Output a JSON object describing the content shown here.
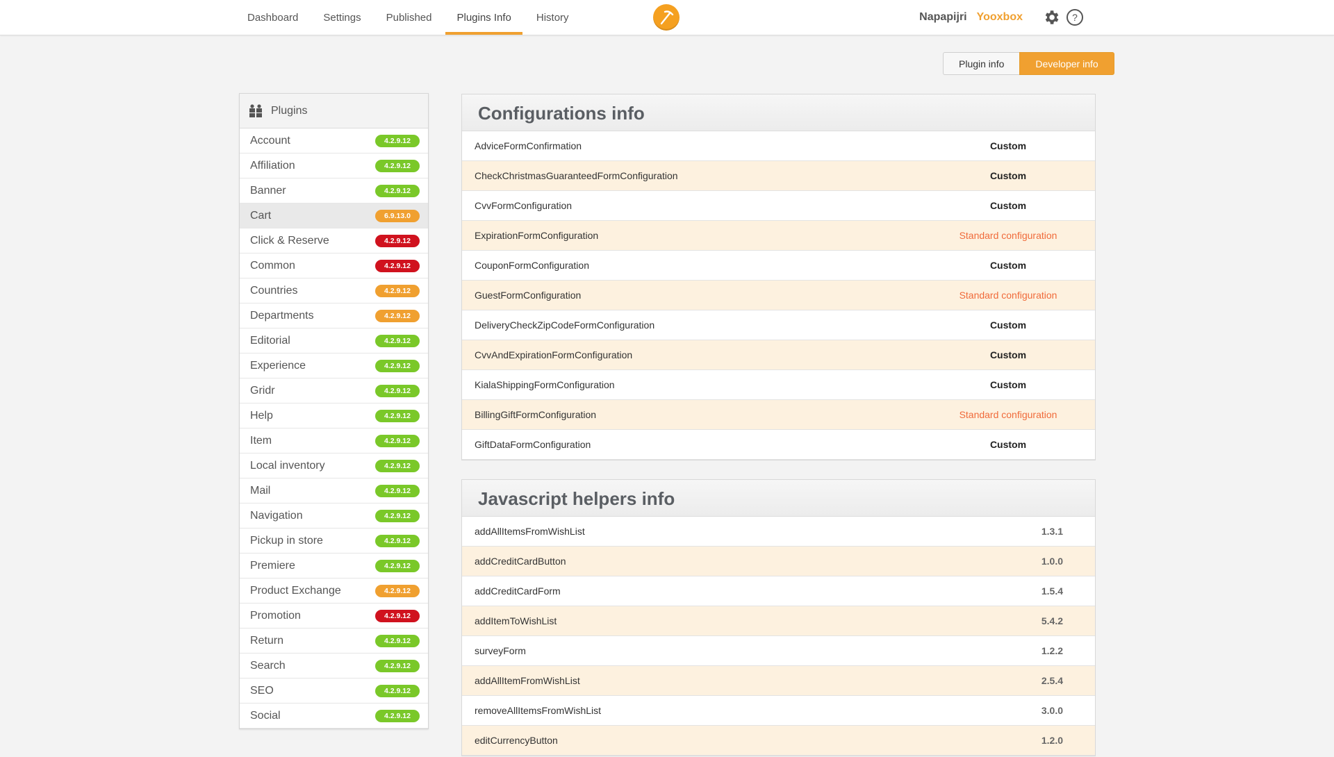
{
  "nav": {
    "items": [
      {
        "label": "Dashboard",
        "active": false
      },
      {
        "label": "Settings",
        "active": false
      },
      {
        "label": "Published",
        "active": false
      },
      {
        "label": "Plugins Info",
        "active": true
      },
      {
        "label": "History",
        "active": false
      }
    ],
    "user": "Napapijri",
    "org": "Yooxbox"
  },
  "toggle": {
    "plugin_info": "Plugin info",
    "developer_info": "Developer info"
  },
  "sidebar": {
    "title": "Plugins",
    "plugins": [
      {
        "name": "Account",
        "version": "4.2.9.12",
        "status": "green"
      },
      {
        "name": "Affiliation",
        "version": "4.2.9.12",
        "status": "green"
      },
      {
        "name": "Banner",
        "version": "4.2.9.12",
        "status": "green"
      },
      {
        "name": "Cart",
        "version": "6.9.13.0",
        "status": "orange",
        "selected": true
      },
      {
        "name": "Click & Reserve",
        "version": "4.2.9.12",
        "status": "red"
      },
      {
        "name": "Common",
        "version": "4.2.9.12",
        "status": "red"
      },
      {
        "name": "Countries",
        "version": "4.2.9.12",
        "status": "orange"
      },
      {
        "name": "Departments",
        "version": "4.2.9.12",
        "status": "orange"
      },
      {
        "name": "Editorial",
        "version": "4.2.9.12",
        "status": "green"
      },
      {
        "name": "Experience",
        "version": "4.2.9.12",
        "status": "green"
      },
      {
        "name": "Gridr",
        "version": "4.2.9.12",
        "status": "green"
      },
      {
        "name": "Help",
        "version": "4.2.9.12",
        "status": "green"
      },
      {
        "name": "Item",
        "version": "4.2.9.12",
        "status": "green"
      },
      {
        "name": "Local inventory",
        "version": "4.2.9.12",
        "status": "green"
      },
      {
        "name": "Mail",
        "version": "4.2.9.12",
        "status": "green"
      },
      {
        "name": "Navigation",
        "version": "4.2.9.12",
        "status": "green"
      },
      {
        "name": "Pickup in store",
        "version": "4.2.9.12",
        "status": "green"
      },
      {
        "name": "Premiere",
        "version": "4.2.9.12",
        "status": "green"
      },
      {
        "name": "Product Exchange",
        "version": "4.2.9.12",
        "status": "orange"
      },
      {
        "name": "Promotion",
        "version": "4.2.9.12",
        "status": "red"
      },
      {
        "name": "Return",
        "version": "4.2.9.12",
        "status": "green"
      },
      {
        "name": "Search",
        "version": "4.2.9.12",
        "status": "green"
      },
      {
        "name": "SEO",
        "version": "4.2.9.12",
        "status": "green"
      },
      {
        "name": "Social",
        "version": "4.2.9.12",
        "status": "green"
      }
    ]
  },
  "colors": {
    "green": "#7ac829",
    "orange": "#f0a030",
    "red": "#d0121e",
    "accent": "#f0a030",
    "standard": "#f06a3a"
  },
  "configurations": {
    "title": "Configurations info",
    "rows": [
      {
        "name": "AdviceFormConfirmation",
        "value": "Custom",
        "standard": false
      },
      {
        "name": "CheckChristmasGuaranteedFormConfiguration",
        "value": "Custom",
        "standard": false
      },
      {
        "name": "CvvFormConfiguration",
        "value": "Custom",
        "standard": false
      },
      {
        "name": "ExpirationFormConfiguration",
        "value": "Standard configuration",
        "standard": true
      },
      {
        "name": "CouponFormConfiguration",
        "value": "Custom",
        "standard": false
      },
      {
        "name": "GuestFormConfiguration",
        "value": "Standard configuration",
        "standard": true
      },
      {
        "name": "DeliveryCheckZipCodeFormConfiguration",
        "value": "Custom",
        "standard": false
      },
      {
        "name": "CvvAndExpirationFormConfiguration",
        "value": "Custom",
        "standard": false
      },
      {
        "name": "KialaShippingFormConfiguration",
        "value": "Custom",
        "standard": false
      },
      {
        "name": "BillingGiftFormConfiguration",
        "value": "Standard configuration",
        "standard": true
      },
      {
        "name": "GiftDataFormConfiguration",
        "value": "Custom",
        "standard": false
      }
    ]
  },
  "helpers": {
    "title": "Javascript helpers info",
    "rows": [
      {
        "name": "addAllItemsFromWishList",
        "version": "1.3.1"
      },
      {
        "name": "addCreditCardButton",
        "version": "1.0.0"
      },
      {
        "name": "addCreditCardForm",
        "version": "1.5.4"
      },
      {
        "name": "addItemToWishList",
        "version": "5.4.2"
      },
      {
        "name": "surveyForm",
        "version": "1.2.2"
      },
      {
        "name": "addAllItemFromWishList",
        "version": "2.5.4"
      },
      {
        "name": "removeAllItemsFromWishList",
        "version": "3.0.0"
      },
      {
        "name": "editCurrencyButton",
        "version": "1.2.0"
      }
    ]
  }
}
